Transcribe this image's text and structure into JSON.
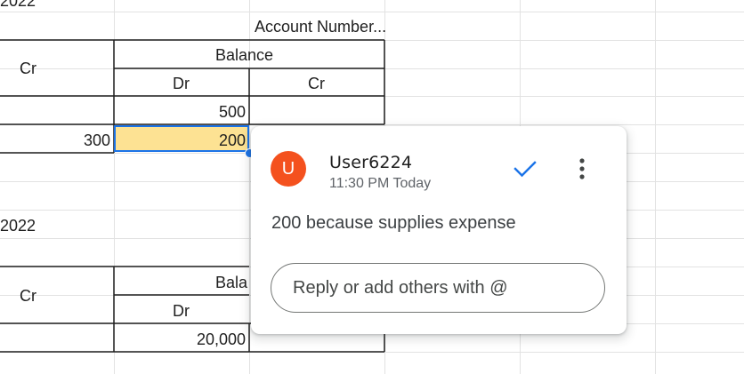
{
  "sheet": {
    "top_partial_text": "2022",
    "header1": {
      "account_number": "Account Number...",
      "cr": "Cr",
      "balance": "Balance",
      "dr": "Dr",
      "cr2": "Cr"
    },
    "rows1": [
      {
        "dr_balance": "500"
      },
      {
        "cr_value": "300",
        "dr_balance": "200"
      }
    ],
    "date2": "2022",
    "header2": {
      "cr": "Cr",
      "balance_partial": "Bala",
      "dr": "Dr"
    },
    "rows2": [
      {
        "dr_balance": "20,000"
      }
    ],
    "colors": {
      "selected_fill": "#fde293",
      "selection_border": "#1a73e8"
    }
  },
  "comment": {
    "avatar_letter": "U",
    "avatar_color": "#f4511e",
    "user": "User6224",
    "time": "11:30 PM Today",
    "text": "200 because supplies expense",
    "reply_placeholder": "Reply or add others with @",
    "icons": {
      "resolve": "check-icon",
      "more": "more-vert-icon"
    }
  }
}
